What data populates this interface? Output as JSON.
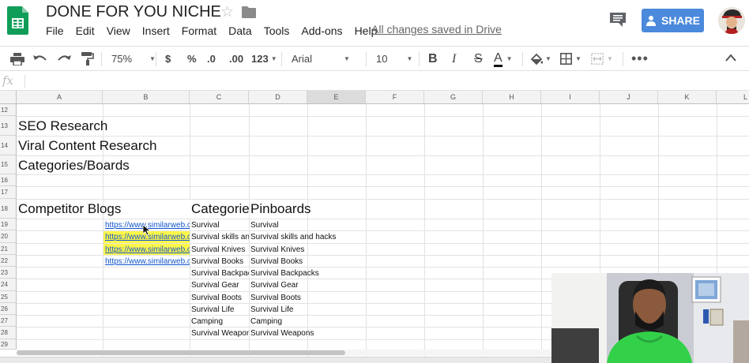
{
  "app": {
    "doc_title": "DONE FOR YOU NICHE",
    "menus": [
      "File",
      "Edit",
      "View",
      "Insert",
      "Format",
      "Data",
      "Tools",
      "Add-ons",
      "Help"
    ],
    "save_status": "All changes saved in Drive",
    "share_label": "SHARE"
  },
  "toolbar": {
    "zoom": "75%",
    "currency": "$",
    "percent": "%",
    "decrease_decimal": ".0",
    "increase_decimal": ".00",
    "number_format": "123",
    "font_family": "Arial",
    "font_size": "10",
    "bold": "B",
    "italic": "I",
    "strike": "S",
    "text_color": "A"
  },
  "formula_bar": {
    "fx": "fx",
    "value": ""
  },
  "columns": [
    "A",
    "B",
    "C",
    "D",
    "E",
    "F",
    "G",
    "H",
    "I",
    "J",
    "K",
    "L"
  ],
  "active_column": "E",
  "rows": [
    "12",
    "13",
    "14",
    "15",
    "16",
    "17",
    "18",
    "19",
    "20",
    "21",
    "22",
    "23",
    "24",
    "25",
    "26",
    "27",
    "28",
    "29"
  ],
  "cells": {
    "r13_a": "SEO Research",
    "r14_a": "Viral Content Research",
    "r15_a": "Categories/Boards",
    "r18_a": "Competitor Blogs",
    "r18_c": "Categories",
    "r18_d": "Pinboards",
    "links": [
      "https://www.similarweb.com/",
      "https://www.similarweb.com/",
      "https://www.similarweb.com/",
      "https://www.similarweb.com/"
    ],
    "categories": [
      "Survival",
      "Survival skills and hacks",
      "Survival Knives",
      "Survival Books",
      "Survival Backpacks",
      "Survival Gear",
      "Survival Boots",
      "Survival Life",
      "Camping",
      "Survival Weapons"
    ],
    "pinboards": [
      "Survival",
      "Survival skills and hacks",
      "Survival Knives",
      "Survival Books",
      "Survival Backpacks",
      "Survival Gear",
      "Survival Boots",
      "Survival Life",
      "Camping",
      "Survival Weapons"
    ]
  },
  "colors": {
    "share_button": "#4b89dc",
    "sheets_green": "#0f9d58",
    "link": "#1155cc",
    "highlight": "#fff84a"
  }
}
